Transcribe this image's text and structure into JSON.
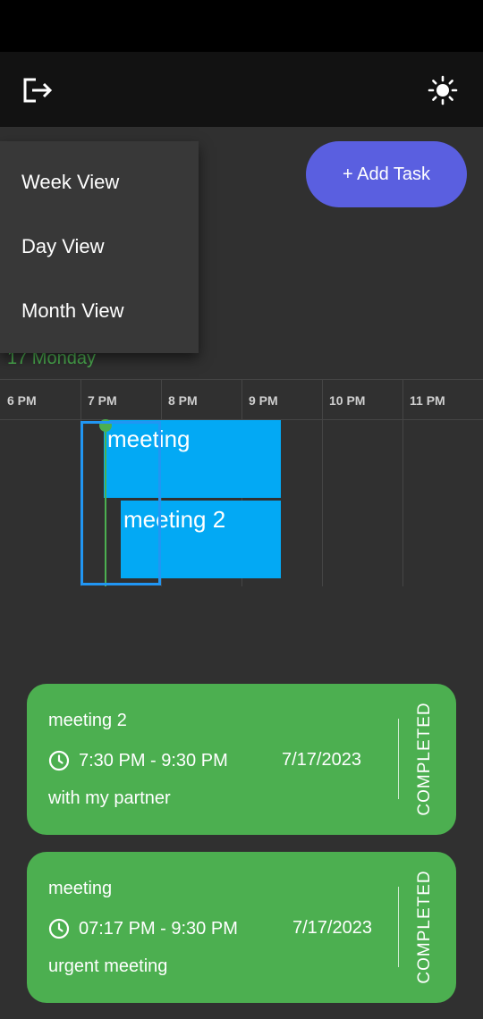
{
  "app_bar": {
    "logout_icon": "logout-icon",
    "theme_icon": "sun-icon"
  },
  "add_task_label": "+ Add Task",
  "view_menu": {
    "items": [
      "Week View",
      "Day View",
      "Month View"
    ]
  },
  "date_label": "17 Monday",
  "timeline": {
    "hours": [
      "6 PM",
      "7 PM",
      "8 PM",
      "9 PM",
      "10 PM",
      "11 PM"
    ],
    "events": [
      {
        "title": "meeting"
      },
      {
        "title": "meeting 2"
      }
    ]
  },
  "tasks": [
    {
      "title": "meeting 2",
      "time": "7:30 PM - 9:30 PM",
      "date": "7/17/2023",
      "description": "with my partner",
      "status": "COMPLETED"
    },
    {
      "title": "meeting",
      "time": "07:17 PM - 9:30 PM",
      "date": "7/17/2023",
      "description": "urgent meeting",
      "status": "COMPLETED"
    }
  ],
  "colors": {
    "accent_button": "#5a5fe0",
    "task_card": "#4caf50",
    "event_block": "#03a9f4",
    "selection": "#2196f3",
    "current_time": "#4caf50"
  }
}
